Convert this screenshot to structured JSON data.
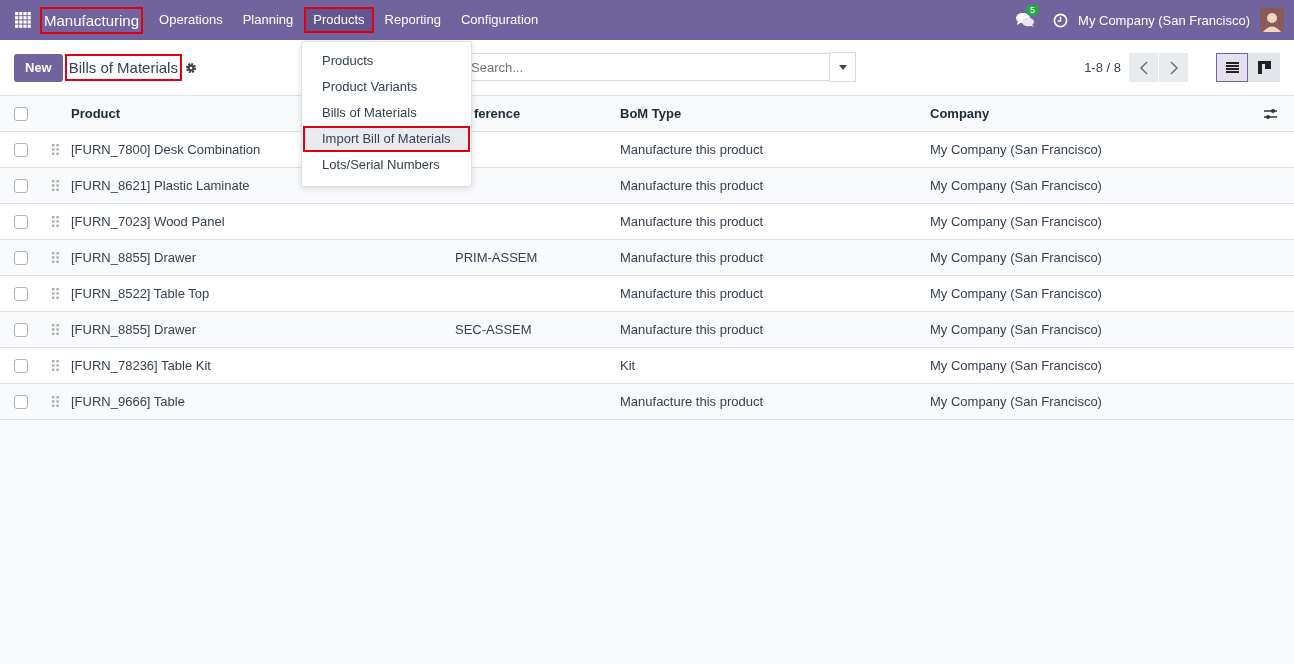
{
  "navbar": {
    "app_name": "Manufacturing",
    "app_highlighted": true,
    "menus": [
      {
        "label": "Operations",
        "selected": false,
        "highlighted": false
      },
      {
        "label": "Planning",
        "selected": false,
        "highlighted": false
      },
      {
        "label": "Products",
        "selected": true,
        "highlighted": true
      },
      {
        "label": "Reporting",
        "selected": false,
        "highlighted": false
      },
      {
        "label": "Configuration",
        "selected": false,
        "highlighted": false
      }
    ],
    "messages_badge": "5",
    "company": "My Company (San Francisco)"
  },
  "control_panel": {
    "new_button": "New",
    "title": "Bills of Materials",
    "title_highlighted": true,
    "search": {
      "placeholder": "Search..."
    },
    "pager": "1-8 / 8",
    "views": [
      {
        "kind": "list",
        "selected": true
      },
      {
        "kind": "kanban",
        "selected": false
      }
    ]
  },
  "dropdown": {
    "items": [
      {
        "label": "Products",
        "highlighted": false,
        "selected": false
      },
      {
        "label": "Product Variants",
        "highlighted": false,
        "selected": false
      },
      {
        "label": "Bills of Materials",
        "highlighted": false,
        "selected": false
      },
      {
        "label": "Import Bill of Materials",
        "highlighted": true,
        "selected": true
      },
      {
        "label": "Lots/Serial Numbers",
        "highlighted": false,
        "selected": false
      }
    ]
  },
  "table": {
    "all_checked": false,
    "columns": [
      "Product",
      "ference",
      "BoM Type",
      "Company"
    ],
    "rows": [
      {
        "checked": false,
        "cells": [
          "[FURN_7800] Desk Combination",
          "",
          "Manufacture this product",
          "My Company (San Francisco)"
        ]
      },
      {
        "checked": false,
        "cells": [
          "[FURN_8621] Plastic Laminate",
          "",
          "Manufacture this product",
          "My Company (San Francisco)"
        ]
      },
      {
        "checked": false,
        "cells": [
          "[FURN_7023] Wood Panel",
          "",
          "Manufacture this product",
          "My Company (San Francisco)"
        ]
      },
      {
        "checked": false,
        "cells": [
          "[FURN_8855] Drawer",
          "PRIM-ASSEM",
          "Manufacture this product",
          "My Company (San Francisco)"
        ]
      },
      {
        "checked": false,
        "cells": [
          "[FURN_8522] Table Top",
          "",
          "Manufacture this product",
          "My Company (San Francisco)"
        ]
      },
      {
        "checked": false,
        "cells": [
          "[FURN_8855] Drawer",
          "SEC-ASSEM",
          "Manufacture this product",
          "My Company (San Francisco)"
        ]
      },
      {
        "checked": false,
        "cells": [
          "[FURN_78236] Table Kit",
          "",
          "Kit",
          "My Company (San Francisco)"
        ]
      },
      {
        "checked": false,
        "cells": [
          "[FURN_9666] Table",
          "",
          "Manufacture this product",
          "My Company (San Francisco)"
        ]
      }
    ]
  }
}
